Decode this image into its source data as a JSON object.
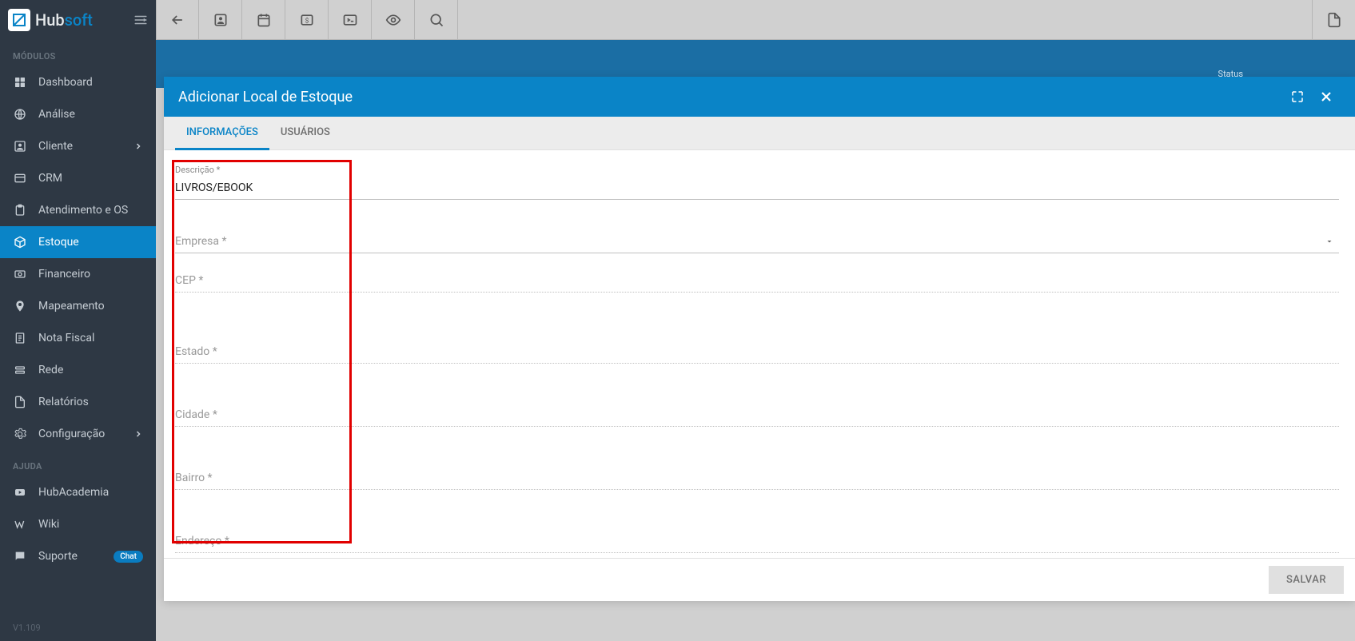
{
  "brand": {
    "hub": "Hub",
    "soft": "soft"
  },
  "sidebar": {
    "section_modulos": "MÓDULOS",
    "section_ajuda": "AJUDA",
    "items": [
      {
        "label": "Dashboard"
      },
      {
        "label": "Análise"
      },
      {
        "label": "Cliente"
      },
      {
        "label": "CRM"
      },
      {
        "label": "Atendimento e OS"
      },
      {
        "label": "Estoque"
      },
      {
        "label": "Financeiro"
      },
      {
        "label": "Mapeamento"
      },
      {
        "label": "Nota Fiscal"
      },
      {
        "label": "Rede"
      },
      {
        "label": "Relatórios"
      },
      {
        "label": "Configuração"
      }
    ],
    "help": [
      {
        "label": "HubAcademia"
      },
      {
        "label": "Wiki"
      },
      {
        "label": "Suporte"
      }
    ],
    "chat_badge": "Chat",
    "version": "V1.109"
  },
  "header": {
    "status_label": "Status"
  },
  "modal": {
    "title": "Adicionar Local de Estoque",
    "tabs": [
      {
        "label": "INFORMAÇÕES",
        "active": true
      },
      {
        "label": "USUÁRIOS",
        "active": false
      }
    ],
    "fields": {
      "descricao_label": "Descrição *",
      "descricao_value": "LIVROS/EBOOK",
      "empresa_placeholder": "Empresa *",
      "cep_placeholder": "CEP *",
      "estado_placeholder": "Estado *",
      "cidade_placeholder": "Cidade *",
      "bairro_placeholder": "Bairro *",
      "endereco_placeholder": "Endereço *"
    },
    "save_label": "SALVAR"
  }
}
